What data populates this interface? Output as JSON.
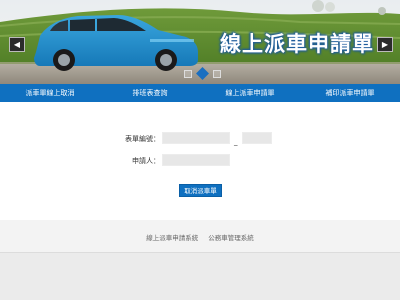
{
  "banner": {
    "title": "線上派車申請單",
    "prev_icon": "◀",
    "next_icon": "▶",
    "slides": 3,
    "active_slide": 2
  },
  "nav": {
    "items": [
      {
        "label": "派車單線上取消"
      },
      {
        "label": "排班表查詢"
      },
      {
        "label": "線上派車申請單"
      },
      {
        "label": "補印派車申請單"
      }
    ]
  },
  "form": {
    "form_number_label": "表單編號：",
    "form_number_value": "",
    "form_number_suffix_value": "",
    "separator": "_",
    "applicant_label": "申請人：",
    "applicant_value": "",
    "cancel_button_label": "取消派車單"
  },
  "footer": {
    "system_name": "線上派車申請系統",
    "org_name": "公務車管理系統"
  },
  "colors": {
    "nav_bg": "#0f70c0",
    "button_bg": "#0f70c0",
    "title_glow": "#1c5aa0"
  }
}
